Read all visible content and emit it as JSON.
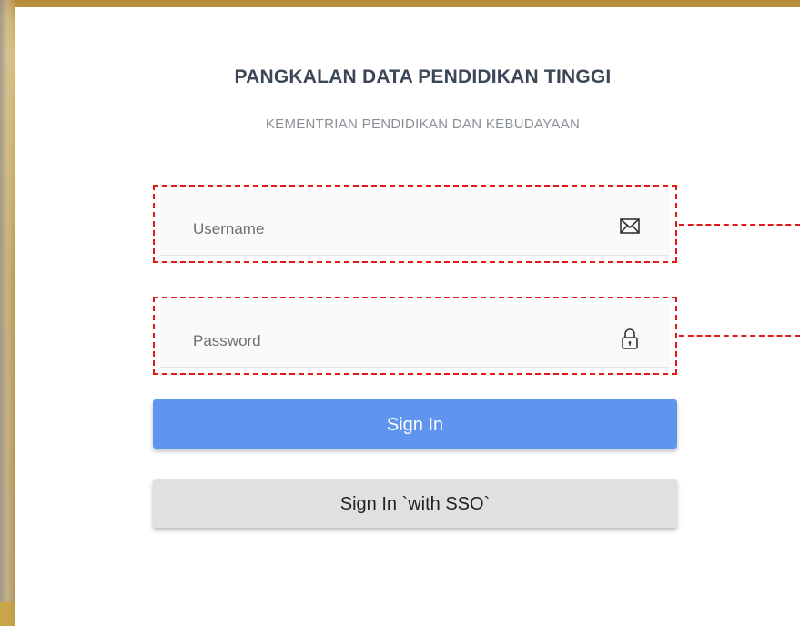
{
  "header": {
    "title": "PANGKALAN DATA PENDIDIKAN TINGGI",
    "subtitle": "KEMENTRIAN PENDIDIKAN DAN KEBUDAYAAN"
  },
  "form": {
    "username": {
      "placeholder": "Username",
      "value": "",
      "icon": "envelope-icon"
    },
    "password": {
      "placeholder": "Password",
      "value": "",
      "icon": "lock-icon"
    }
  },
  "buttons": {
    "sign_in": "Sign In",
    "sign_in_sso": "Sign In `with SSO`"
  },
  "colors": {
    "primary_button": "#5f95ee",
    "secondary_button": "#e0e0e0",
    "highlight": "#e01818",
    "title": "#3b4656"
  }
}
